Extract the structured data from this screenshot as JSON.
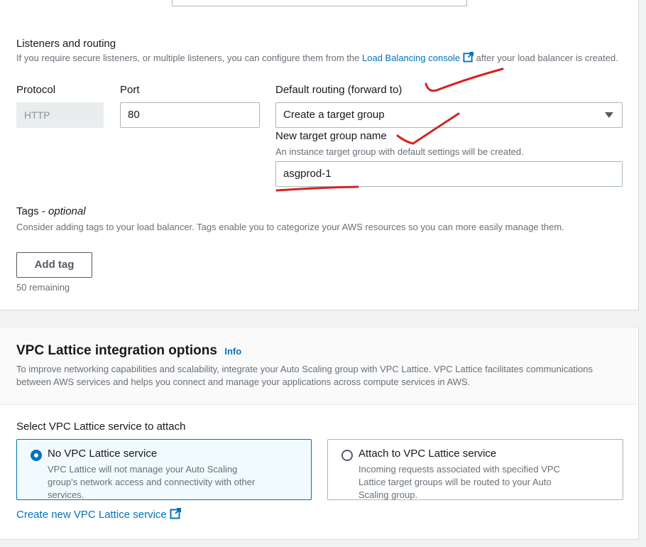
{
  "listeners": {
    "heading": "Listeners and routing",
    "desc_before": "If you require secure listeners, or multiple listeners, you can configure them from the ",
    "desc_link": "Load Balancing console",
    "desc_after": " after your load balancer is created.",
    "protocol_label": "Protocol",
    "protocol_value": "HTTP",
    "port_label": "Port",
    "port_value": "80",
    "routing_label": "Default routing (forward to)",
    "routing_value": "Create a target group",
    "tg_name_label": "New target group name",
    "tg_name_desc": "An instance target group with default settings will be created.",
    "tg_name_value": "asgprod-1"
  },
  "tags": {
    "heading": "Tags",
    "optional": "optional",
    "separator": " - ",
    "desc": "Consider adding tags to your load balancer. Tags enable you to categorize your AWS resources so you can more easily manage them.",
    "add_button": "Add tag",
    "remaining": "50 remaining"
  },
  "vpc_lattice": {
    "title": "VPC Lattice integration options",
    "info": "Info",
    "desc": "To improve networking capabilities and scalability, integrate your Auto Scaling group with VPC Lattice. VPC Lattice facilitates communications between AWS services and helps you connect and manage your applications across compute services in AWS.",
    "select_label": "Select VPC Lattice service to attach",
    "options": [
      {
        "title": "No VPC Lattice service",
        "desc": "VPC Lattice will not manage your Auto Scaling group's network access and connectivity with other services.",
        "selected": true
      },
      {
        "title": "Attach to VPC Lattice service",
        "desc": "Incoming requests associated with specified VPC Lattice target groups will be routed to your Auto Scaling group.",
        "selected": false
      }
    ],
    "create_link": "Create new VPC Lattice service"
  },
  "colors": {
    "link": "#0073bb",
    "annotation": "#d62222",
    "selected_bg": "#f1faff"
  },
  "icons": [
    "external-link-icon",
    "caret-down-icon",
    "radio-icon"
  ]
}
